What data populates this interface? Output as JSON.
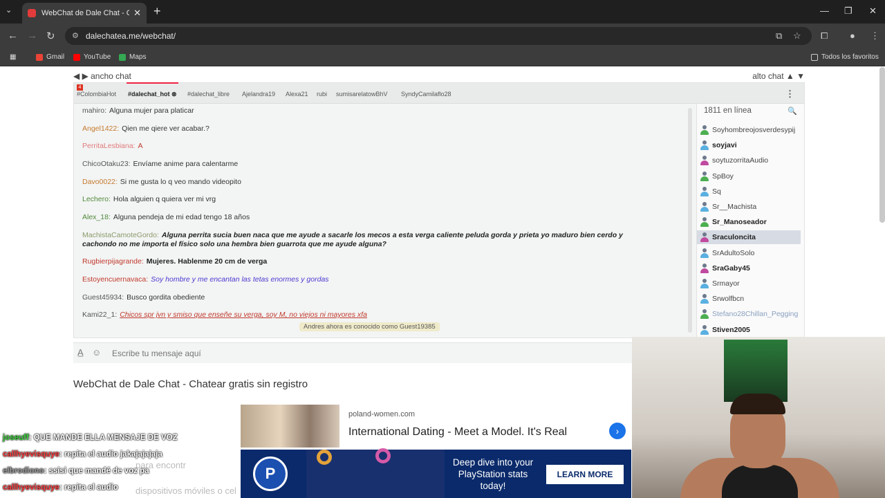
{
  "browser": {
    "tab_title": "WebChat de Dale Chat - Chatear",
    "url": "dalechatea.me/webchat/",
    "bookmarks": [
      {
        "label": "Gmail",
        "color": "#ea4335"
      },
      {
        "label": "YouTube",
        "color": "#ff0000"
      },
      {
        "label": "Maps",
        "color": "#34a853"
      }
    ],
    "all_bookmarks": "Todos los favoritos"
  },
  "chat": {
    "width_label": "ancho chat",
    "height_label": "alto chat",
    "badge": "4",
    "tabs": [
      "#ColombiaHot",
      "#dalechat_hot",
      "#dalechat_libre",
      "Ajelandra19",
      "Alexa21",
      "rubi",
      "sumisarelatowBhV",
      "SyndyCamilaflo28"
    ],
    "messages": [
      {
        "user": "mahiro:",
        "text": "Alguna mujer para platicar",
        "user_color": "#555555",
        "text_color": "#333333",
        "style": "normal"
      },
      {
        "user": "Angel1422:",
        "text": "Qien me qiere ver acabar.?",
        "user_color": "#c57a2e",
        "text_color": "#333333",
        "style": "normal"
      },
      {
        "user": "PerritaLesbiana:",
        "text": "A",
        "user_color": "#e07a7a",
        "text_color": "#c0392b",
        "style": "normal"
      },
      {
        "user": "ChicoOtaku23:",
        "text": "Envíame anime para calentarme",
        "user_color": "#555555",
        "text_color": "#333333",
        "style": "normal"
      },
      {
        "user": "Davo0022:",
        "text": "Si me gusta lo q veo mando videopito",
        "user_color": "#c57a2e",
        "text_color": "#333333",
        "style": "normal"
      },
      {
        "user": "Lechero:",
        "text": "Hola alguien q quiera ver mi vrg",
        "user_color": "#4f8a3a",
        "text_color": "#333333",
        "style": "normal"
      },
      {
        "user": "Alex_18:",
        "text": "Alguna pendeja de mi edad tengo 18 años",
        "user_color": "#4f8a3a",
        "text_color": "#333333",
        "style": "normal"
      },
      {
        "user": "MachistaCamoteGordo:",
        "text": "Alguna perrita sucia buen naca  que me ayude a sacarle los mecos a esta verga caliente peluda gorda y prieta yo maduro bien cerdo y cachondo no me importa el físico solo una hembra bien guarrota que me ayude alguna?",
        "user_color": "#8a9a6a",
        "text_color": "#222222",
        "style": "bold-italic"
      },
      {
        "user": "Rugbierpijagrande:",
        "text": "Mujeres. Hablenme 20 cm de verga",
        "user_color": "#c0392b",
        "text_color": "#222222",
        "style": "bold"
      },
      {
        "user": "Estoyencuernavaca:",
        "text": "Soy hombre y me encantan las tetas enormes y gordas",
        "user_color": "#c0392b",
        "text_color": "#4a3ad0",
        "style": "italic"
      },
      {
        "user": "Guest45934:",
        "text": "Busco gordita obediente",
        "user_color": "#555555",
        "text_color": "#333333",
        "style": "normal"
      },
      {
        "user": "Kami22_1:",
        "text": "Chicos spr jvn y smiso que enseñe su verga, soy M, no viejos ni mayores xfa",
        "user_color": "#555555",
        "text_color": "#c0392b",
        "style": "italic-underline"
      }
    ],
    "system_notice": "Andres ahora es conocido como Guest19385",
    "online_count": "1811 en línea",
    "users": [
      {
        "name": "Soyhombreojosverdesypij",
        "gender": "m",
        "bold": false,
        "muted": false
      },
      {
        "name": "soyjavi",
        "gender": "m",
        "bold": true,
        "muted": false
      },
      {
        "name": "soytuzorritaAudio",
        "gender": "f",
        "bold": false,
        "muted": false
      },
      {
        "name": "SpBoy",
        "gender": "m",
        "bold": false,
        "muted": false
      },
      {
        "name": "Sq",
        "gender": "m",
        "bold": false,
        "muted": false
      },
      {
        "name": "Sr__Machista",
        "gender": "m",
        "bold": false,
        "muted": false
      },
      {
        "name": "Sr_Manoseador",
        "gender": "m",
        "bold": true,
        "muted": false
      },
      {
        "name": "Sraculoncita",
        "gender": "f",
        "bold": true,
        "muted": false
      },
      {
        "name": "SrAdultoSolo",
        "gender": "m",
        "bold": false,
        "muted": false
      },
      {
        "name": "SraGaby45",
        "gender": "f",
        "bold": true,
        "muted": false
      },
      {
        "name": "Srmayor",
        "gender": "m",
        "bold": false,
        "muted": false
      },
      {
        "name": "Srwolfbcn",
        "gender": "m",
        "bold": false,
        "muted": false
      },
      {
        "name": "Stefano28Chillan_Pegging",
        "gender": "m",
        "bold": false,
        "muted": true
      },
      {
        "name": "Stiven2005",
        "gender": "m",
        "bold": true,
        "muted": false
      }
    ],
    "highlighted_user": "Sraculoncita",
    "input_placeholder": "Escribe tu mensaje aquí"
  },
  "page": {
    "title": "WebChat de Dale Chat - Chatear gratis sin registro",
    "faded_text_1": "para encontr",
    "faded_text_2": "dispositivos móviles o cel"
  },
  "overlay_chat": [
    {
      "user": "joseuff",
      "text": ": QUE MANDE ELLA MENSAJE DE VOZ",
      "color": "#3ad13a"
    },
    {
      "user": "callhyevisquye",
      "text": ": repita el audio jakajajajaja",
      "color": "#ff3b3b"
    },
    {
      "user": "elbrodiono",
      "text": ": ssisi que mandé de voz pa",
      "color": "#9a9a9a"
    },
    {
      "user": "callhyevisquye",
      "text": ": repita el audio",
      "color": "#ff3b3b"
    }
  ],
  "ads": {
    "ad1_domain": "poland-women.com",
    "ad1_headline": "International Dating - Meet a Model. It's Real",
    "ad2_text": "Deep dive into your PlayStation stats today!",
    "ad2_cta": "LEARN MORE"
  },
  "colors": {
    "accent": "#e22244",
    "male_avatar": "#5ab0e0",
    "female_avatar": "#c04aa0"
  }
}
